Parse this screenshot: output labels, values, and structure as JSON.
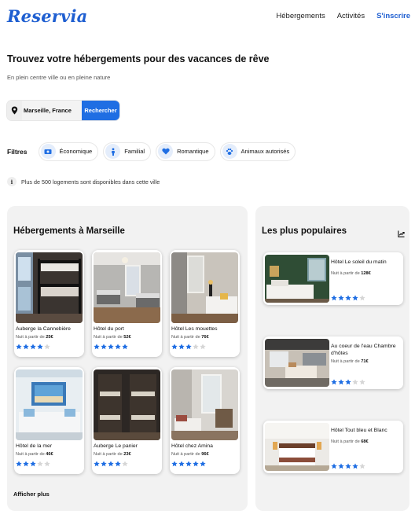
{
  "header": {
    "logo": "Reservia",
    "nav": [
      {
        "label": "Hébergements"
      },
      {
        "label": "Activités"
      },
      {
        "label": "S'inscrire"
      }
    ]
  },
  "hero": {
    "title": "Trouvez votre hébergements pour des vacances de rêve",
    "subtitle": "En plein centre ville ou en pleine nature"
  },
  "search": {
    "value": "Marseille, France",
    "button": "Rechercher",
    "icon": "location-pin-icon"
  },
  "filters": {
    "label": "Filtres",
    "items": [
      {
        "label": "Économique",
        "icon": "money-icon"
      },
      {
        "label": "Familial",
        "icon": "family-icon"
      },
      {
        "label": "Romantique",
        "icon": "heart-icon"
      },
      {
        "label": "Animaux autorisés",
        "icon": "paw-icon"
      }
    ]
  },
  "info": {
    "text": "Plus de 500 logements sont disponibles dans cette ville",
    "icon": "info-icon"
  },
  "hebergements": {
    "title": "Hébergements à Marseille",
    "more": "Afficher plus",
    "items": [
      {
        "name": "Auberge la Cannebière",
        "price_prefix": "Nuit à partir de",
        "price": "25€",
        "rating": 4
      },
      {
        "name": "Hôtel du port",
        "price_prefix": "Nuit à partir de",
        "price": "52€",
        "rating": 5
      },
      {
        "name": "Hôtel Les mouettes",
        "price_prefix": "Nuit à partir de",
        "price": "76€",
        "rating": 3
      },
      {
        "name": "Hôtel de la mer",
        "price_prefix": "Nuit à partir de",
        "price": "46€",
        "rating": 3
      },
      {
        "name": "Auberge Le panier",
        "price_prefix": "Nuit à partir de",
        "price": "23€",
        "rating": 4
      },
      {
        "name": "Hôtel chez Amina",
        "price_prefix": "Nuit à partir de",
        "price": "96€",
        "rating": 5
      }
    ]
  },
  "populaires": {
    "title": "Les plus populaires",
    "icon": "trending-icon",
    "items": [
      {
        "name": "Hôtel Le soleil du matin",
        "price_prefix": "Nuit à partir de",
        "price": "128€",
        "rating": 4
      },
      {
        "name": "Au coeur de l'eau Chambre d'hôtes",
        "price_prefix": "Nuit à partir de",
        "price": "71€",
        "rating": 3
      },
      {
        "name": "Hôtel Tout bleu et Blanc",
        "price_prefix": "Nuit à partir de",
        "price": "68€",
        "rating": 4
      }
    ]
  },
  "colors": {
    "accent": "#1f6ee3",
    "logo": "#1f5fd1",
    "star_on": "#1f6ee3",
    "star_off": "#d6d6d6"
  }
}
